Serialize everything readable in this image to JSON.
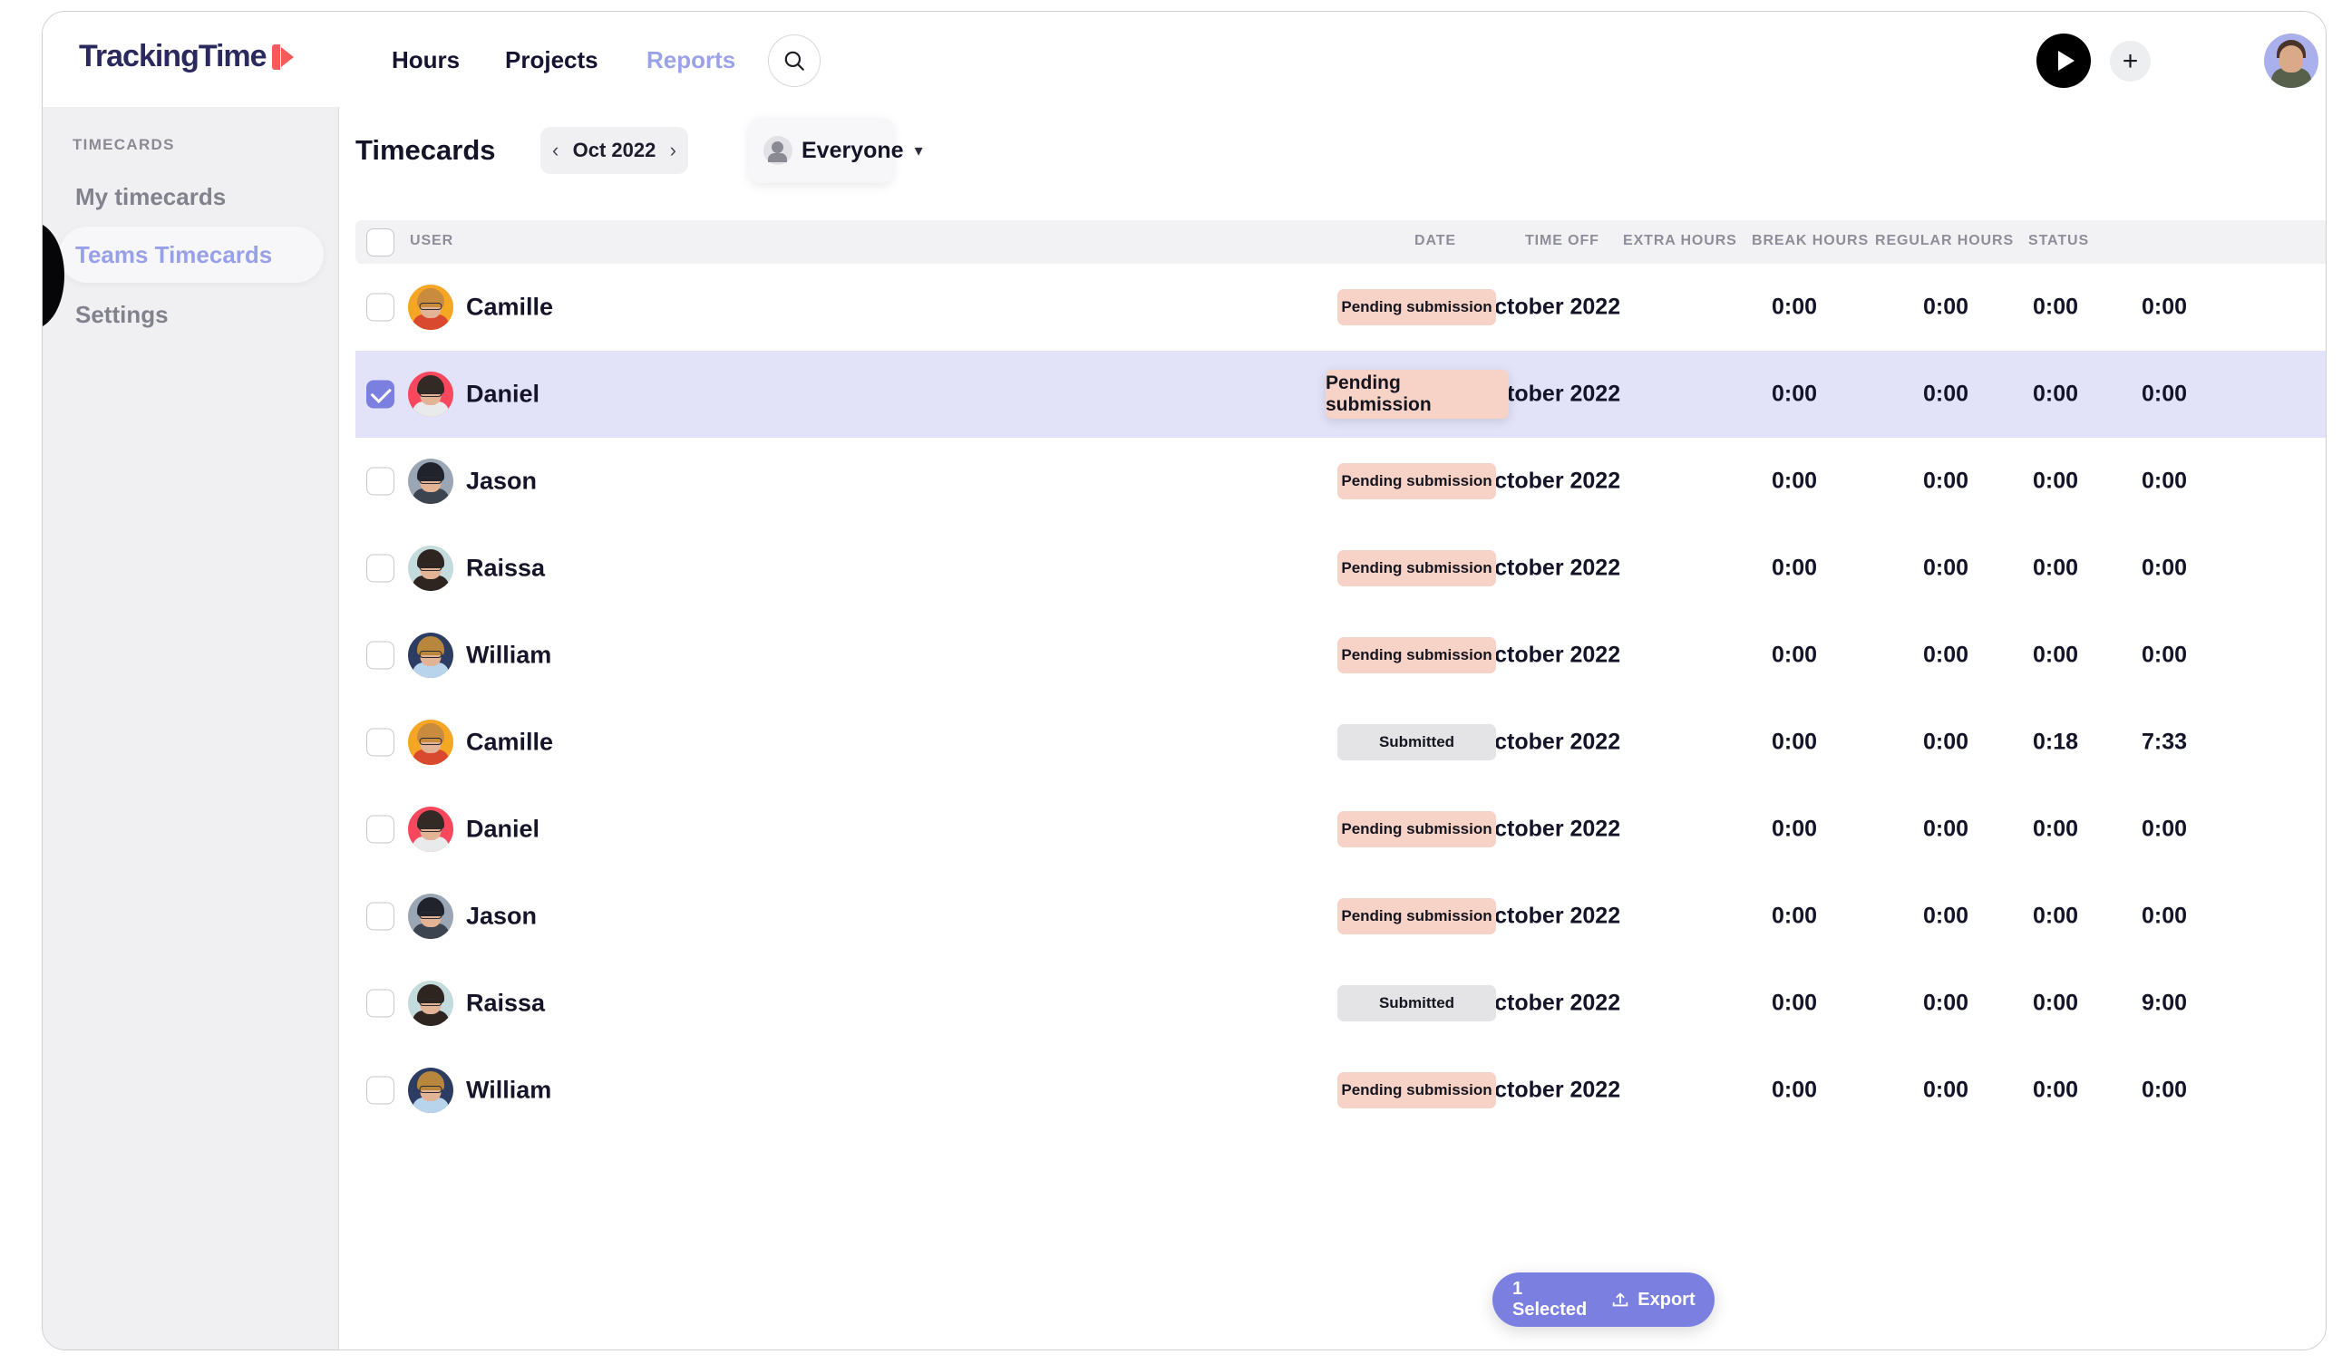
{
  "brand": {
    "name": "TrackingTime",
    "logo_color": "#2b2a5e",
    "mark_color": "#fb5a5a"
  },
  "topnav": {
    "links": [
      {
        "label": "Hours",
        "active": false
      },
      {
        "label": "Projects",
        "active": false
      },
      {
        "label": "Reports",
        "active": true
      }
    ],
    "search_icon": "search-icon",
    "play_icon": "play-icon",
    "add_label": "+",
    "avatar": "user-avatar"
  },
  "sidebar": {
    "heading": "TIMECARDS",
    "items": [
      {
        "label": "My timecards",
        "active": false
      },
      {
        "label": "Teams Timecards",
        "active": true
      },
      {
        "label": "Settings",
        "active": false
      }
    ]
  },
  "toolbar": {
    "title": "Timecards",
    "month": "Oct 2022",
    "prev_icon": "‹",
    "next_icon": "›",
    "filter_label": "Everyone",
    "filter_caret": "⌄"
  },
  "table": {
    "columns": [
      "USER",
      "DATE",
      "TIME OFF",
      "EXTRA HOURS",
      "BREAK HOURS",
      "REGULAR HOURS",
      "STATUS"
    ],
    "rows": [
      {
        "user": "Camille",
        "avatar": "camille",
        "date": "october 2022",
        "time_off": "0:00",
        "extra_hours": "0:00",
        "break_hours": "0:00",
        "regular_hours": "0:00",
        "status": "Pending submission",
        "status_kind": "pending",
        "selected": false
      },
      {
        "user": "Daniel",
        "avatar": "daniel",
        "date": "october 2022",
        "time_off": "0:00",
        "extra_hours": "0:00",
        "break_hours": "0:00",
        "regular_hours": "0:00",
        "status": "Pending submission",
        "status_kind": "pending",
        "selected": true
      },
      {
        "user": "Jason",
        "avatar": "jason",
        "date": "october 2022",
        "time_off": "0:00",
        "extra_hours": "0:00",
        "break_hours": "0:00",
        "regular_hours": "0:00",
        "status": "Pending submission",
        "status_kind": "pending",
        "selected": false
      },
      {
        "user": "Raissa",
        "avatar": "raissa",
        "date": "october 2022",
        "time_off": "0:00",
        "extra_hours": "0:00",
        "break_hours": "0:00",
        "regular_hours": "0:00",
        "status": "Pending submission",
        "status_kind": "pending",
        "selected": false
      },
      {
        "user": "William",
        "avatar": "william",
        "date": "october 2022",
        "time_off": "0:00",
        "extra_hours": "0:00",
        "break_hours": "0:00",
        "regular_hours": "0:00",
        "status": "Pending submission",
        "status_kind": "pending",
        "selected": false
      },
      {
        "user": "Camille",
        "avatar": "camille",
        "date": "october 2022",
        "time_off": "0:00",
        "extra_hours": "0:00",
        "break_hours": "0:18",
        "regular_hours": "7:33",
        "status": "Submitted",
        "status_kind": "submitted",
        "selected": false
      },
      {
        "user": "Daniel",
        "avatar": "daniel",
        "date": "october 2022",
        "time_off": "0:00",
        "extra_hours": "0:00",
        "break_hours": "0:00",
        "regular_hours": "0:00",
        "status": "Pending submission",
        "status_kind": "pending",
        "selected": false
      },
      {
        "user": "Jason",
        "avatar": "jason",
        "date": "october 2022",
        "time_off": "0:00",
        "extra_hours": "0:00",
        "break_hours": "0:00",
        "regular_hours": "0:00",
        "status": "Pending submission",
        "status_kind": "pending",
        "selected": false
      },
      {
        "user": "Raissa",
        "avatar": "raissa",
        "date": "october 2022",
        "time_off": "0:00",
        "extra_hours": "0:00",
        "break_hours": "0:00",
        "regular_hours": "9:00",
        "status": "Submitted",
        "status_kind": "submitted",
        "selected": false
      },
      {
        "user": "William",
        "avatar": "william",
        "date": "october 2022",
        "time_off": "0:00",
        "extra_hours": "0:00",
        "break_hours": "0:00",
        "regular_hours": "0:00",
        "status": "Pending submission",
        "status_kind": "pending",
        "selected": false
      }
    ]
  },
  "action_bar": {
    "selected_label": "1 Selected",
    "export_label": "Export",
    "export_icon": "upload-icon",
    "close_icon": "close-icon"
  },
  "colors": {
    "accent": "#7b80e0",
    "selected_row": "#e2e2f8",
    "pending_badge": "#f7d2c7",
    "submitted_badge": "#e4e4e6",
    "sidebar_bg": "#f0f0f2",
    "active_nav": "#9ba3e8"
  },
  "avatar_colors": {
    "camille": {
      "bg": "#f5a623",
      "hair": "#c98b3d",
      "body": "#d8492f"
    },
    "daniel": {
      "bg": "#f9485e",
      "hair": "#332a26",
      "body": "#e9eaec"
    },
    "jason": {
      "bg": "#9aa6b4",
      "hair": "#20232b",
      "body": "#3c4450"
    },
    "raissa": {
      "bg": "#c3dbdd",
      "hair": "#2e2420",
      "body": "#2e2420"
    },
    "william": {
      "bg": "#2c3c63",
      "hair": "#b8863d",
      "body": "#b7d4ec"
    }
  },
  "layout": {
    "col_x": {
      "user": 60,
      "date": 1208,
      "time_off": 1532,
      "extra_hours": 1699,
      "break_hours": 1820,
      "regular_hours": 1940,
      "status": 1100
    },
    "head_x": {
      "user": 60,
      "date": 1168,
      "time_off": 1446,
      "extra_hours": 1578,
      "break_hours": 1710,
      "regular_hours": 1850,
      "status": 2040
    }
  }
}
